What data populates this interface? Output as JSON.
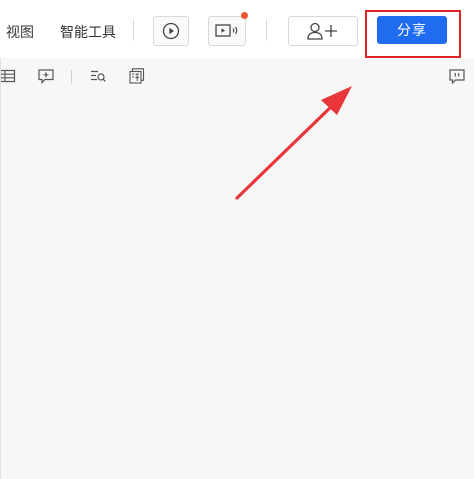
{
  "menu": {
    "view": "视图",
    "smart_tools": "智能工具"
  },
  "toolbar": {
    "share_label": "分享"
  },
  "colors": {
    "share_button": "#1f6cf0",
    "highlight_box": "#e02424",
    "arrow": "#e8363a",
    "notification_dot": "#f0542d"
  },
  "icons": {
    "play": "play-icon",
    "presentation": "presentation-audio-icon",
    "add_user": "add-user-icon",
    "table": "table-icon",
    "comment_add": "comment-add-icon",
    "find_list": "list-search-icon",
    "translate": "translate-icon",
    "comment": "comment-icon"
  }
}
